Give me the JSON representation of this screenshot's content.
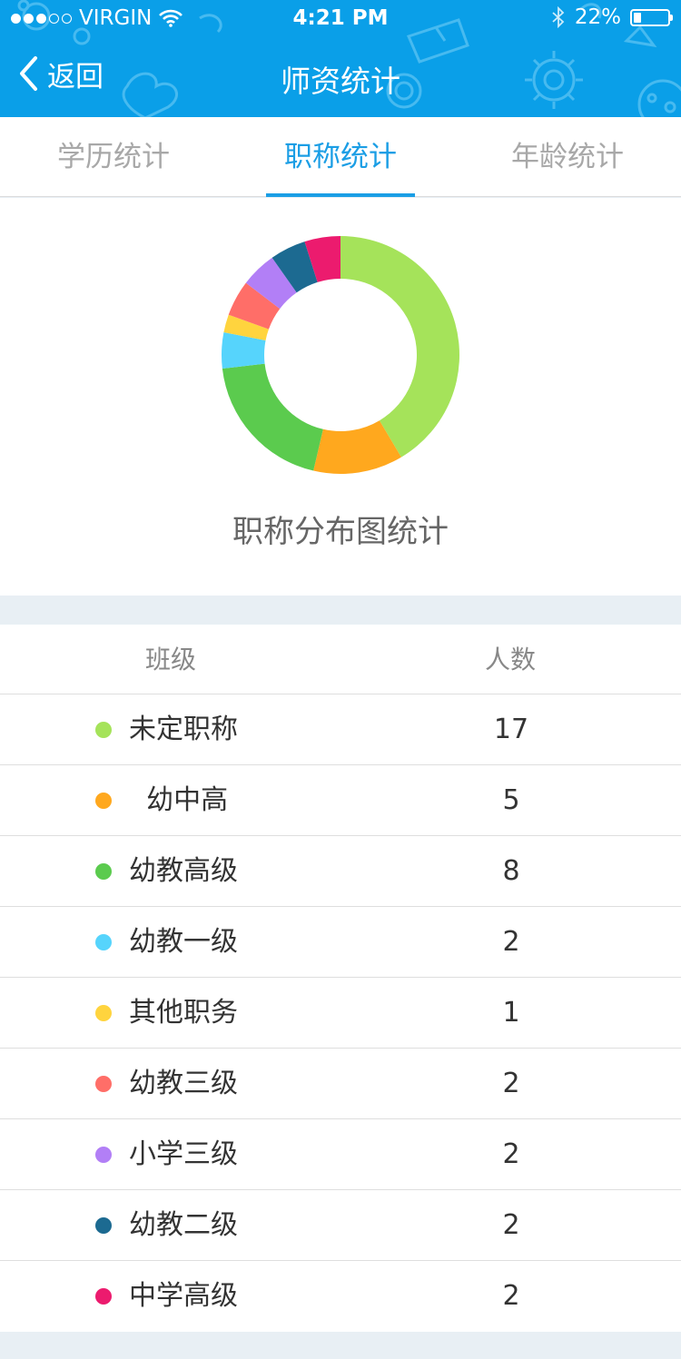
{
  "status_bar": {
    "carrier": "VIRGIN",
    "time": "4:21 PM",
    "battery": "22%",
    "battery_level": 0.22,
    "signal_bars_filled": 3,
    "signal_bars_total": 5,
    "icons": [
      "wifi-icon",
      "bluetooth-icon",
      "battery-icon"
    ]
  },
  "nav": {
    "back_label": "返回",
    "title": "师资统计"
  },
  "tabs": [
    {
      "label": "学历统计",
      "active": false
    },
    {
      "label": "职称统计",
      "active": true
    },
    {
      "label": "年龄统计",
      "active": false
    }
  ],
  "chart_caption": "职称分布图统计",
  "chart_data": {
    "type": "pie",
    "categories": [
      "未定职称",
      "幼中高",
      "幼教高级",
      "幼教一级",
      "其他职务",
      "幼教三级",
      "小学三级",
      "幼教二级",
      "中学高级"
    ],
    "values": [
      17,
      5,
      8,
      2,
      1,
      2,
      2,
      2,
      2
    ],
    "colors": [
      "#a5e35a",
      "#ffa81e",
      "#5bcb4e",
      "#56d4fc",
      "#ffd43e",
      "#ff6e68",
      "#b27ff6",
      "#1c6a91",
      "#ec1b6e"
    ],
    "donut": true
  },
  "table": {
    "header_class": "班级",
    "header_count": "人数",
    "rows": [
      {
        "label": "未定职称",
        "count": "17",
        "color": "#a5e35a"
      },
      {
        "label": "  幼中高",
        "count": "5",
        "color": "#ffa81e"
      },
      {
        "label": "幼教高级",
        "count": "8",
        "color": "#5bcb4e"
      },
      {
        "label": "幼教一级",
        "count": "2",
        "color": "#56d4fc"
      },
      {
        "label": "其他职务",
        "count": "1",
        "color": "#ffd43e"
      },
      {
        "label": "幼教三级",
        "count": "2",
        "color": "#ff6e68"
      },
      {
        "label": "小学三级",
        "count": "2",
        "color": "#b27ff6"
      },
      {
        "label": "幼教二级",
        "count": "2",
        "color": "#1c6a91"
      },
      {
        "label": "中学高级",
        "count": "2",
        "color": "#ec1b6e"
      }
    ]
  },
  "colors": {
    "header_bg": "#0a9fe8",
    "accent": "#1b9ee5",
    "page_bg": "#e8eff4"
  }
}
